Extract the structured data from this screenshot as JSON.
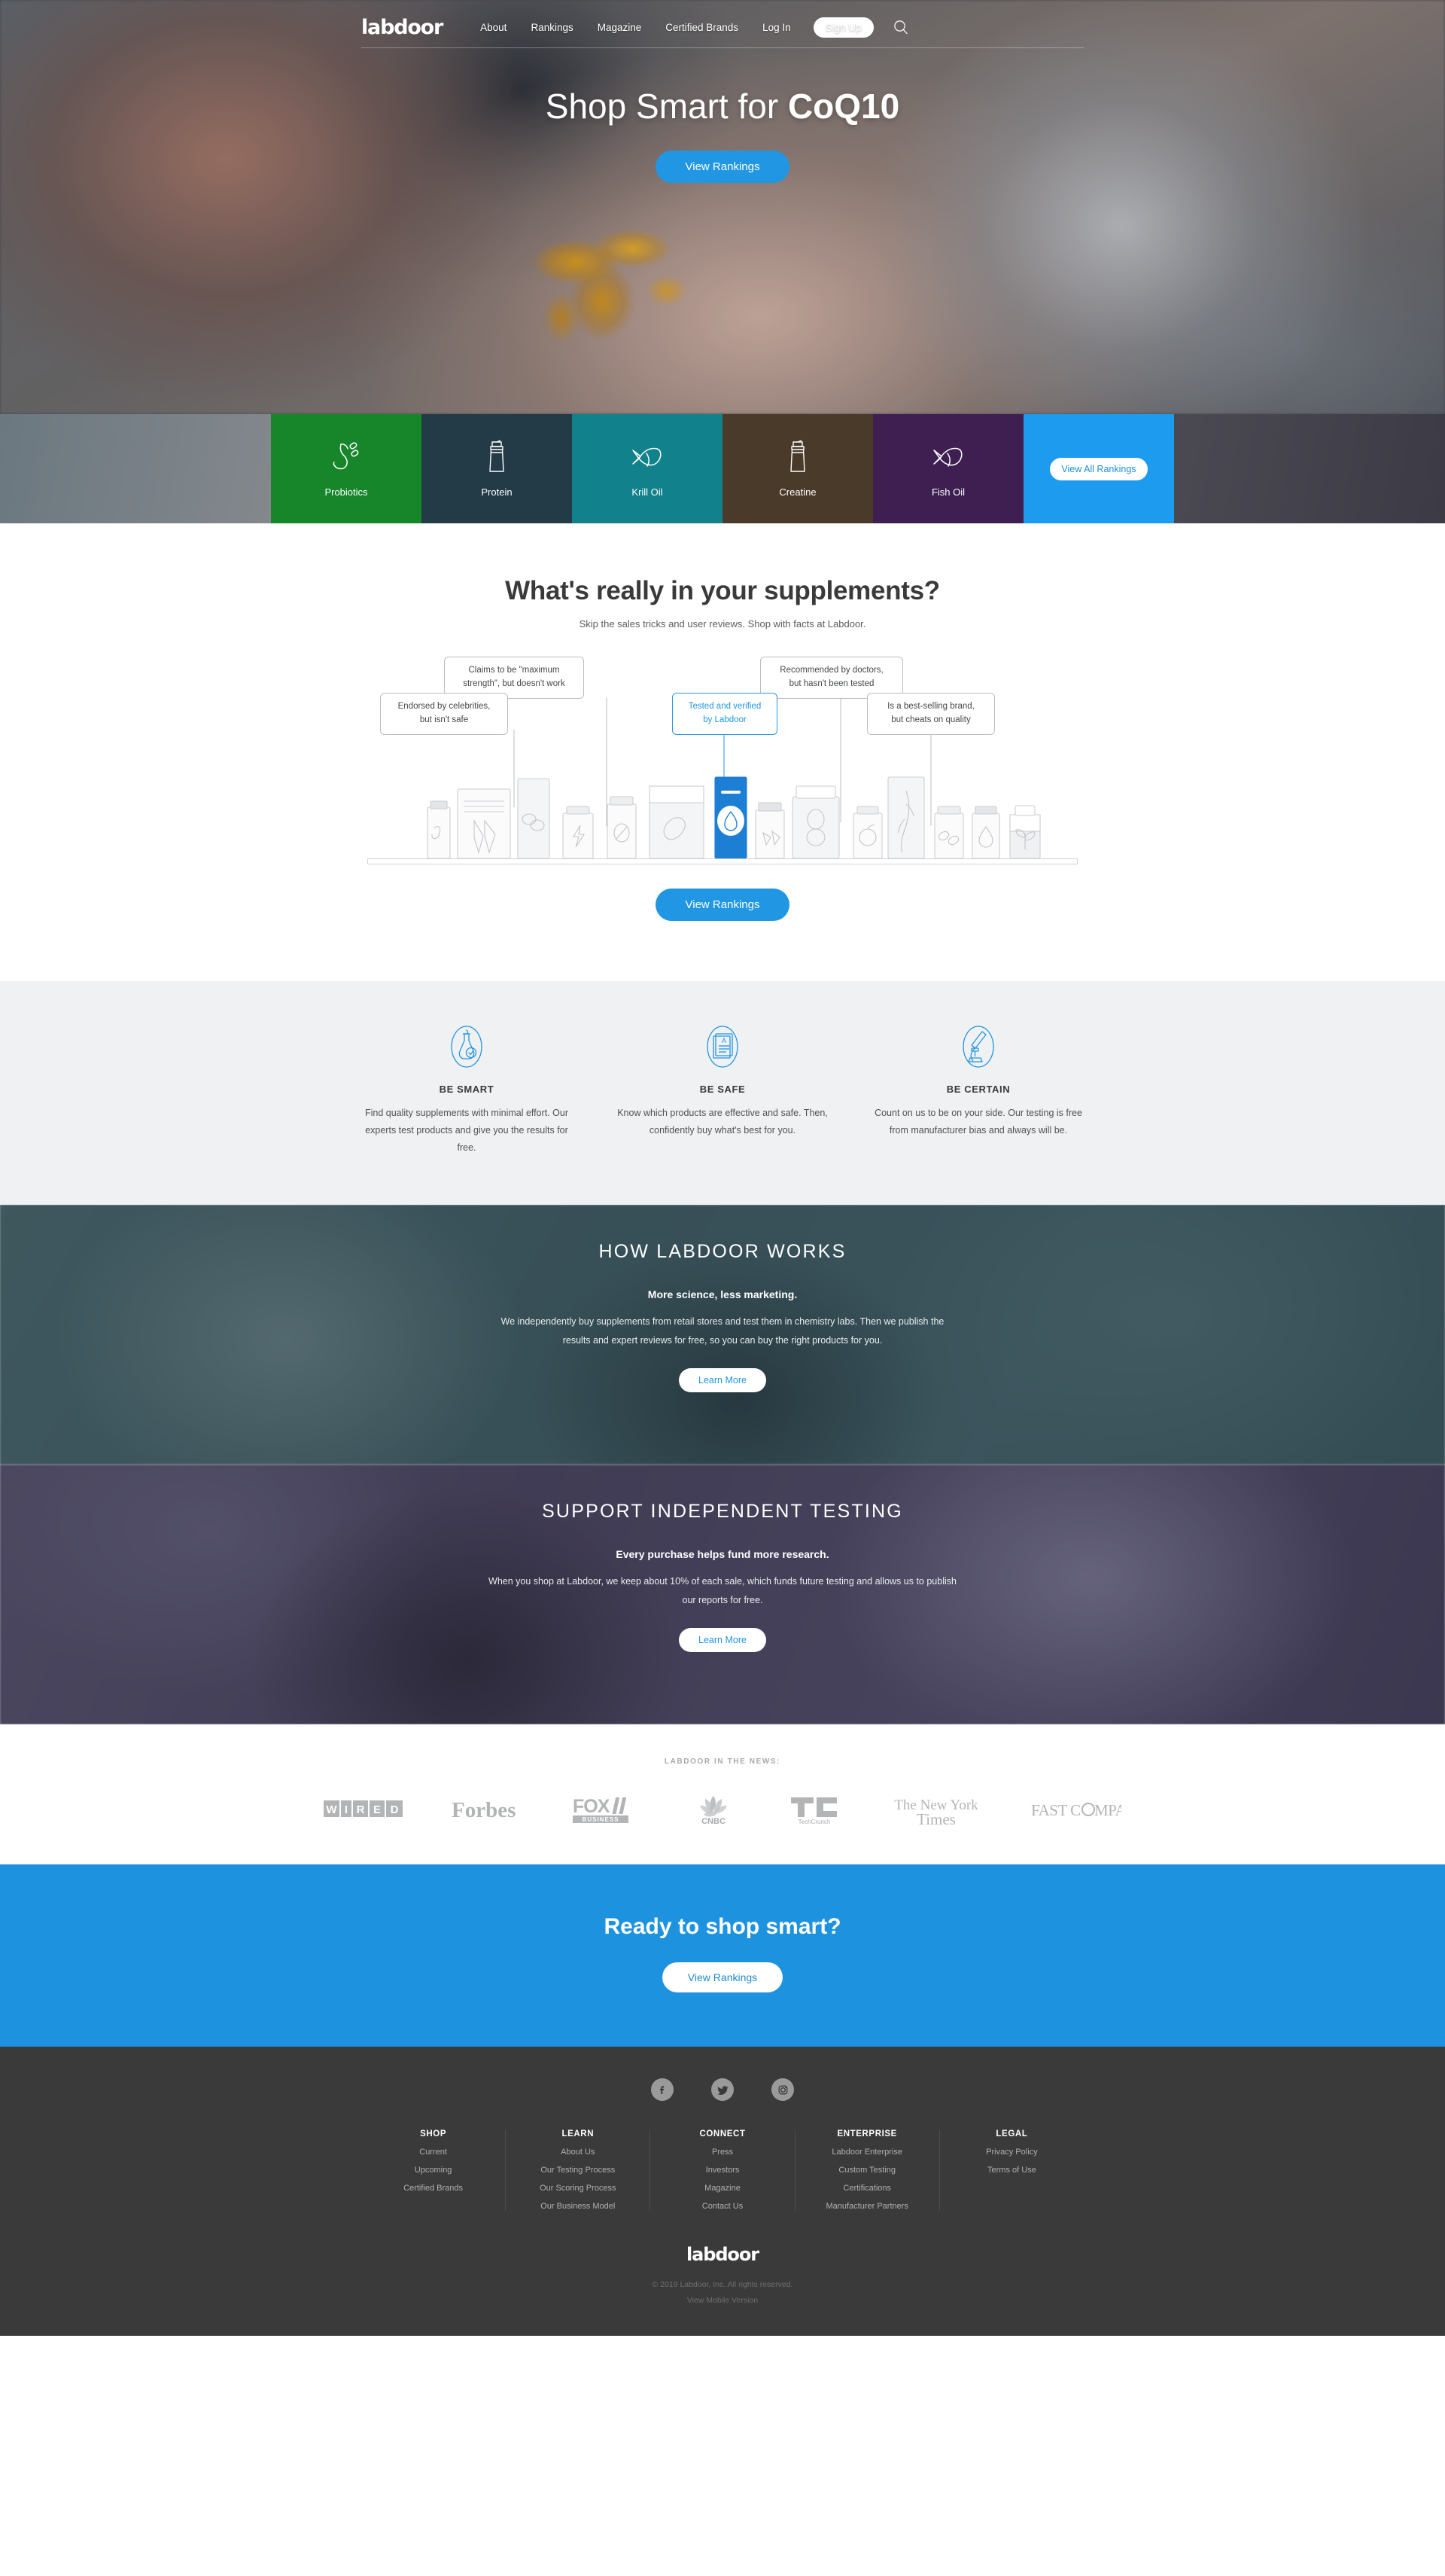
{
  "brand": {
    "name": "labdoor",
    "accent": "#2196e3"
  },
  "header": {
    "logo": "labdoor",
    "nav": [
      {
        "label": "About"
      },
      {
        "label": "Rankings"
      },
      {
        "label": "Magazine"
      },
      {
        "label": "Certified Brands"
      },
      {
        "label": "Log In"
      }
    ],
    "signup_label": "Sign Up",
    "search_icon": "search-icon"
  },
  "hero": {
    "title_prefix": "Shop Smart for ",
    "title_highlight": "CoQ10",
    "cta_label": "View Rankings"
  },
  "categories": {
    "items": [
      {
        "label": "Probiotics",
        "color": "#17862a",
        "icon": "stomach-icon"
      },
      {
        "label": "Protein",
        "color": "#233a47",
        "icon": "shaker-bottle-icon"
      },
      {
        "label": "Krill Oil",
        "color": "#11828c",
        "icon": "krill-icon"
      },
      {
        "label": "Creatine",
        "color": "#4a3a29",
        "icon": "shaker-bottle-icon"
      },
      {
        "label": "Fish Oil",
        "color": "#3f1f52",
        "icon": "fish-icon"
      }
    ],
    "view_all_label": "View All Rankings",
    "view_all_color": "#1d9bef"
  },
  "supplements": {
    "heading": "What's really in your supplements?",
    "subheading": "Skip the sales tricks and user reviews. Shop with facts at Labdoor.",
    "cta_label": "View Rankings",
    "bubbles": [
      {
        "line1": "Claims to be \"maximum",
        "line2": "strength\", but doesn't work",
        "highlight": false
      },
      {
        "line1": "Recommended by doctors,",
        "line2": "but hasn't been tested",
        "highlight": false
      },
      {
        "line1": "Endorsed by celebrities,",
        "line2": "but isn't safe",
        "highlight": false
      },
      {
        "line1": "Tested and verified",
        "line2": "by Labdoor",
        "highlight": true
      },
      {
        "line1": "Is a best-selling brand,",
        "line2": "but cheats on quality",
        "highlight": false
      }
    ]
  },
  "values": [
    {
      "icon": "flask-check-icon",
      "title": "BE SMART",
      "body": "Find quality supplements with minimal effort. Our experts test products and give you the results for free."
    },
    {
      "icon": "report-grade-icon",
      "title": "BE SAFE",
      "body": "Know which products are effective and safe. Then, confidently buy what's best for you."
    },
    {
      "icon": "microscope-icon",
      "title": "BE CERTAIN",
      "body": "Count on us to be on your side. Our testing is free from manufacturer bias and always will be."
    }
  ],
  "how_it_works": {
    "heading": "HOW LABDOOR WORKS",
    "lead": "More science, less marketing.",
    "body": "We independently buy supplements from retail stores and test them in chemistry labs. Then we publish the results and expert reviews for free, so you can buy the right products for you.",
    "cta_label": "Learn More"
  },
  "support": {
    "heading": "SUPPORT INDEPENDENT TESTING",
    "lead": "Every purchase helps fund more research.",
    "body": "When you shop at Labdoor, we keep about 10% of each sale, which funds future testing and allows us to publish our reports for free.",
    "cta_label": "Learn More"
  },
  "press": {
    "label": "LABDOOR IN THE NEWS:",
    "logos": [
      {
        "name": "WIRED"
      },
      {
        "name": "Forbes"
      },
      {
        "name": "FOX BUSINESS"
      },
      {
        "name": "CNBC"
      },
      {
        "name": "TechCrunch"
      },
      {
        "name": "The New York Times"
      },
      {
        "name": "FAST COMPANY"
      }
    ]
  },
  "cta": {
    "title": "Ready to shop smart?",
    "button_label": "View Rankings"
  },
  "footer": {
    "social": [
      {
        "name": "facebook-icon"
      },
      {
        "name": "twitter-icon"
      },
      {
        "name": "instagram-icon"
      }
    ],
    "columns": [
      {
        "heading": "SHOP",
        "links": [
          "Current",
          "Upcoming",
          "Certified Brands"
        ]
      },
      {
        "heading": "LEARN",
        "links": [
          "About Us",
          "Our Testing Process",
          "Our Scoring Process",
          "Our Business Model"
        ]
      },
      {
        "heading": "CONNECT",
        "links": [
          "Press",
          "Investors",
          "Magazine",
          "Contact Us"
        ]
      },
      {
        "heading": "ENTERPRISE",
        "links": [
          "Labdoor Enterprise",
          "Custom Testing",
          "Certifications",
          "Manufacturer Partners"
        ]
      },
      {
        "heading": "LEGAL",
        "links": [
          "Privacy Policy",
          "Terms of Use"
        ]
      }
    ],
    "logo": "labdoor",
    "copyright": "© 2019 Labdoor, Inc. All rights reserved.",
    "mobile_link": "View Mobile Version"
  }
}
